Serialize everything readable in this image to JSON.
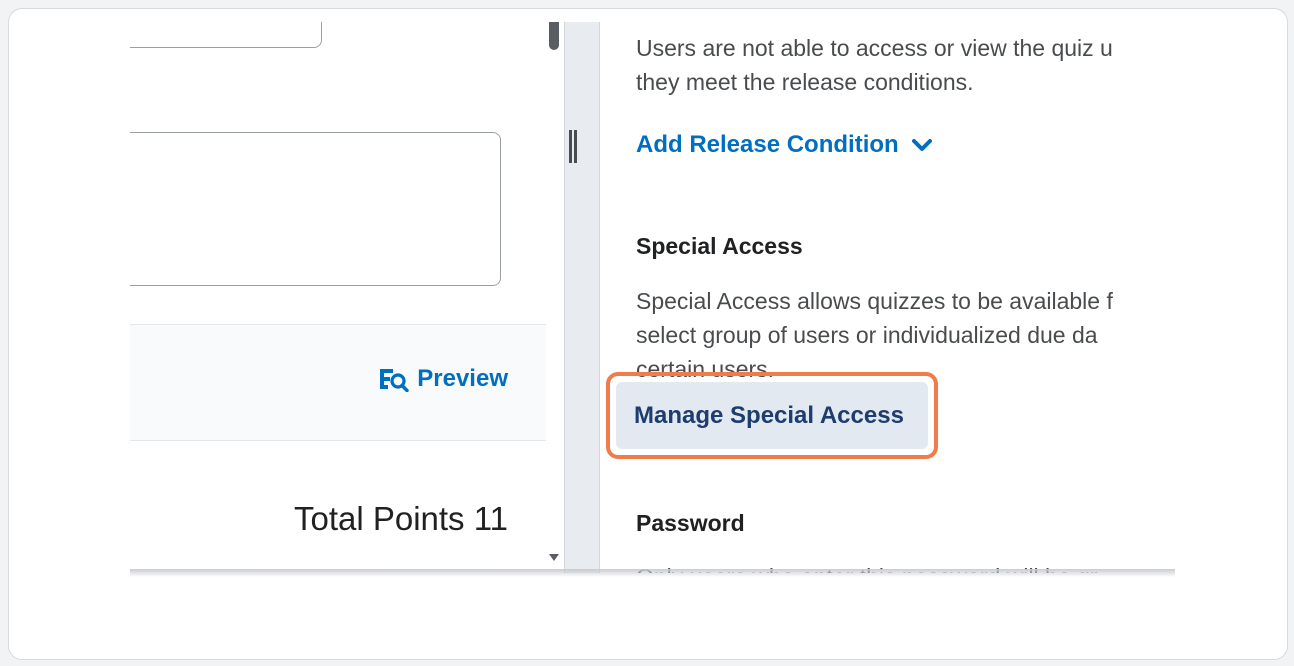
{
  "left_panel": {
    "preview_label": "Preview",
    "total_points": "Total Points 11"
  },
  "right_panel": {
    "release_text": "Users are not able to access or view the quiz u\nthey meet the release conditions.",
    "add_release_label": "Add Release Condition",
    "special_access_heading": "Special Access",
    "special_access_text": "Special Access allows quizzes to be available f\nselect group of users or individualized due da\ncertain users.",
    "manage_special_access_label": "Manage Special Access",
    "password_heading": "Password",
    "password_text": "Only users who enter this password will be gr"
  },
  "icons": {
    "preview": "preview-magnifier-icon",
    "chevron": "chevron-down-icon"
  },
  "colors": {
    "link_blue": "#006fbf",
    "highlight_orange": "#f07c4b",
    "button_bg": "#e3e9f1",
    "button_text": "#1d3d6e"
  }
}
